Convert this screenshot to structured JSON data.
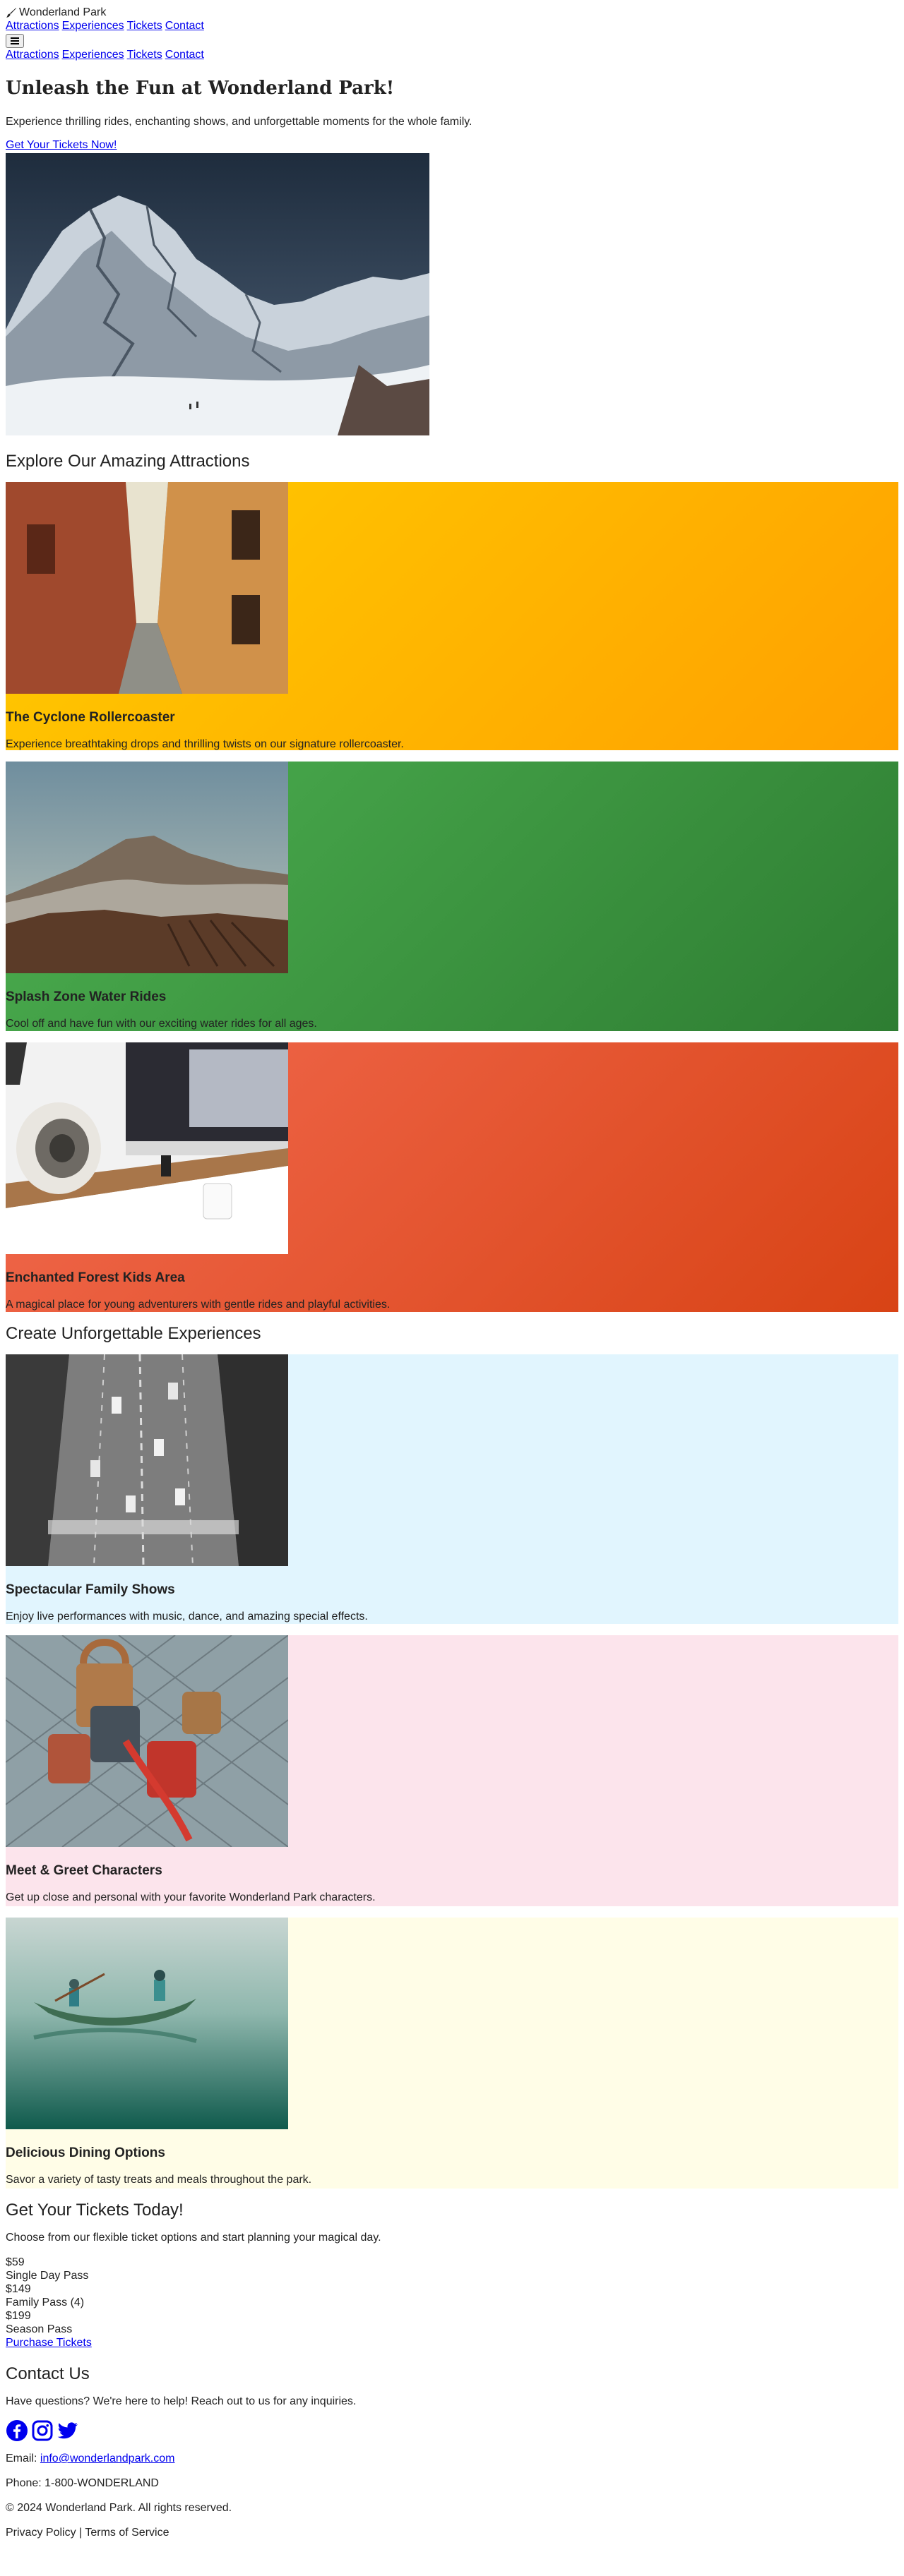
{
  "brand": {
    "name": "Wonderland Park"
  },
  "nav": {
    "links": [
      "Attractions",
      "Experiences",
      "Tickets",
      "Contact"
    ],
    "menu_icon": "hamburger-icon"
  },
  "hero": {
    "title": "Unleash the Fun at Wonderland Park!",
    "subtitle": "Experience thrilling rides, enchanting shows, and unforgettable moments for the whole family.",
    "cta": "Get Your Tickets Now!"
  },
  "attractions": {
    "title": "Explore Our Amazing Attractions",
    "items": [
      {
        "title": "The Cyclone Rollercoaster",
        "desc": "Experience breathtaking drops and thrilling twists on our signature rollercoaster.",
        "color": "#ffb300"
      },
      {
        "title": "Splash Zone Water Rides",
        "desc": "Cool off and have fun with our exciting water rides for all ages.",
        "color": "#43a047"
      },
      {
        "title": "Enchanted Forest Kids Area",
        "desc": "A magical place for young adventurers with gentle rides and playful activities.",
        "color": "#e64a19"
      }
    ]
  },
  "experiences": {
    "title": "Create Unforgettable Experiences",
    "items": [
      {
        "title": "Spectacular Family Shows",
        "desc": "Enjoy live performances with music, dance, and amazing special effects.",
        "color": "#e1f5fe"
      },
      {
        "title": "Meet & Greet Characters",
        "desc": "Get up close and personal with your favorite Wonderland Park characters.",
        "color": "#fce4ec"
      },
      {
        "title": "Delicious Dining Options",
        "desc": "Savor a variety of tasty treats and meals throughout the park.",
        "color": "#fffde7"
      }
    ]
  },
  "tickets": {
    "title": "Get Your Tickets Today!",
    "subtitle": "Choose from our flexible ticket options and start planning your magical day.",
    "options": [
      {
        "price": "$59",
        "name": "Single Day Pass"
      },
      {
        "price": "$149",
        "name": "Family Pass (4)"
      },
      {
        "price": "$199",
        "name": "Season Pass"
      }
    ],
    "cta": "Purchase Tickets"
  },
  "contact": {
    "title": "Contact Us",
    "subtitle": "Have questions? We're here to help! Reach out to us for any inquiries.",
    "social": [
      "facebook-icon",
      "instagram-icon",
      "twitter-icon"
    ],
    "email_label": "Email:",
    "email": "info@wonderlandpark.com",
    "phone": "Phone: 1-800-WONDERLAND"
  },
  "footer": {
    "copyright": "© 2024 Wonderland Park. All rights reserved.",
    "privacy": "Privacy Policy",
    "separator": "|",
    "terms": "Terms of Service"
  }
}
